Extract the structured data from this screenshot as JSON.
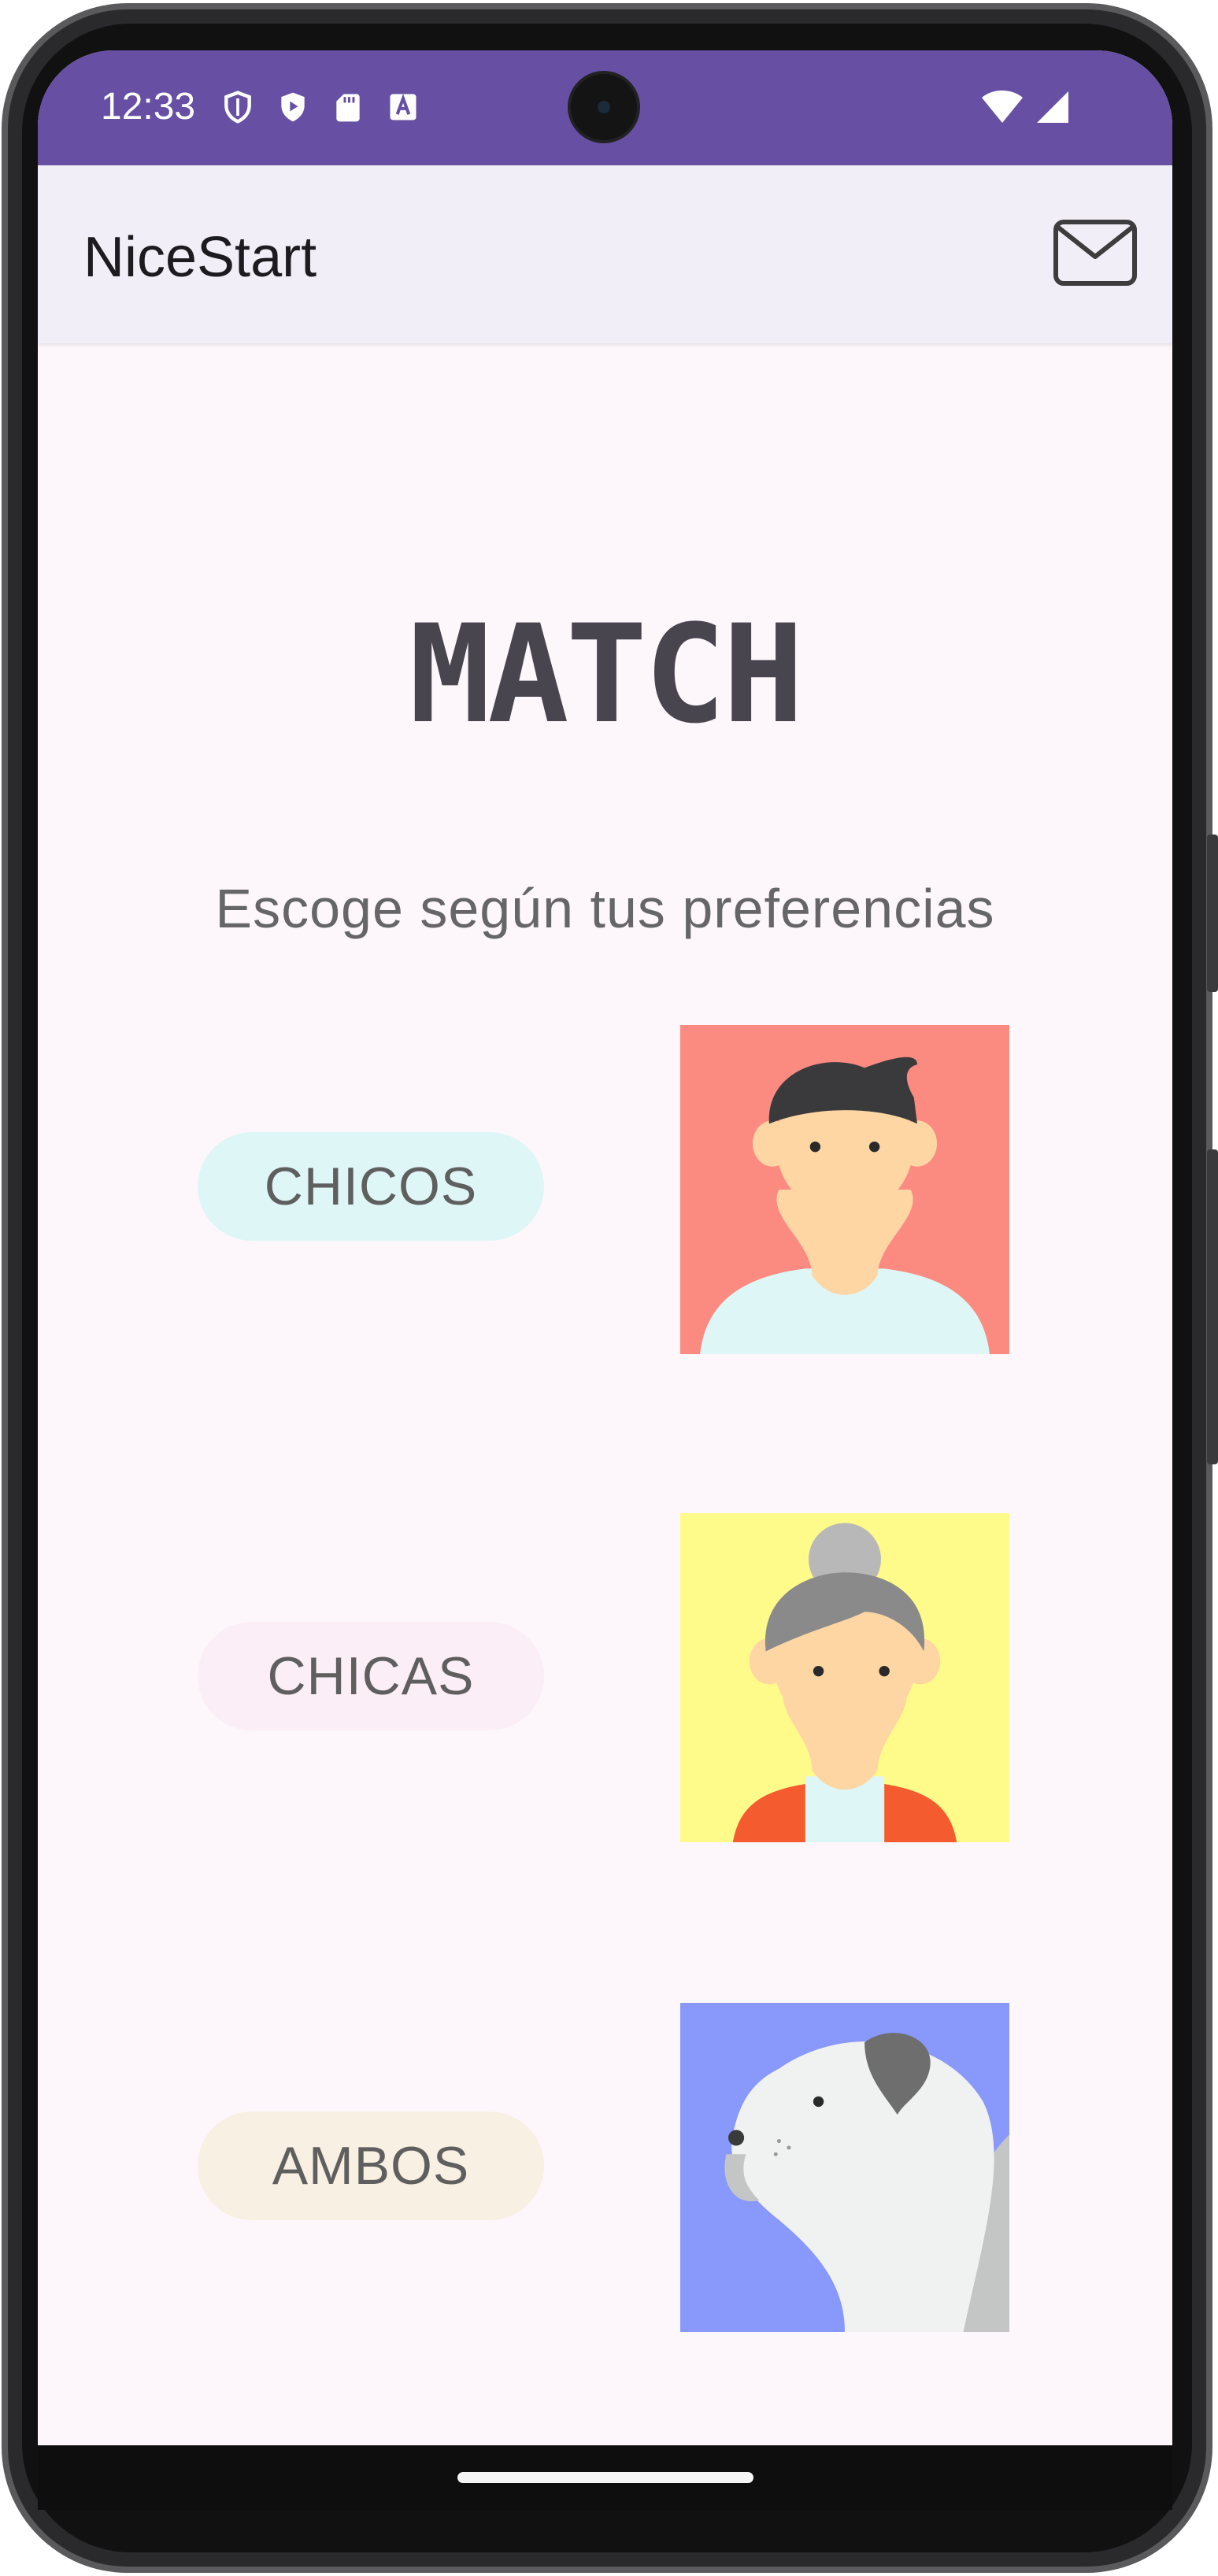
{
  "status_bar": {
    "time": "12:33",
    "icons": [
      "shield-outline-icon",
      "play-protect-icon",
      "sd-card-icon",
      "accessibility-a-icon"
    ],
    "right_icons": [
      "wifi-icon",
      "cell-signal-icon"
    ],
    "background": "#6750a4"
  },
  "app_bar": {
    "title": "NiceStart",
    "action_icon": "mail-icon",
    "background": "#f2eef7"
  },
  "main": {
    "title": "MATCH",
    "subtitle": "Escoge según tus preferencias",
    "options": [
      {
        "label": "CHICOS",
        "button_color": "#dff6f6",
        "image": "boy-avatar",
        "image_bg": "#fb8a80"
      },
      {
        "label": "CHICAS",
        "button_color": "#fbeef6",
        "image": "grandma-avatar",
        "image_bg": "#fffb8a"
      },
      {
        "label": "AMBOS",
        "button_color": "#f8f0e2",
        "image": "dog-avatar",
        "image_bg": "#8898fb"
      }
    ]
  }
}
